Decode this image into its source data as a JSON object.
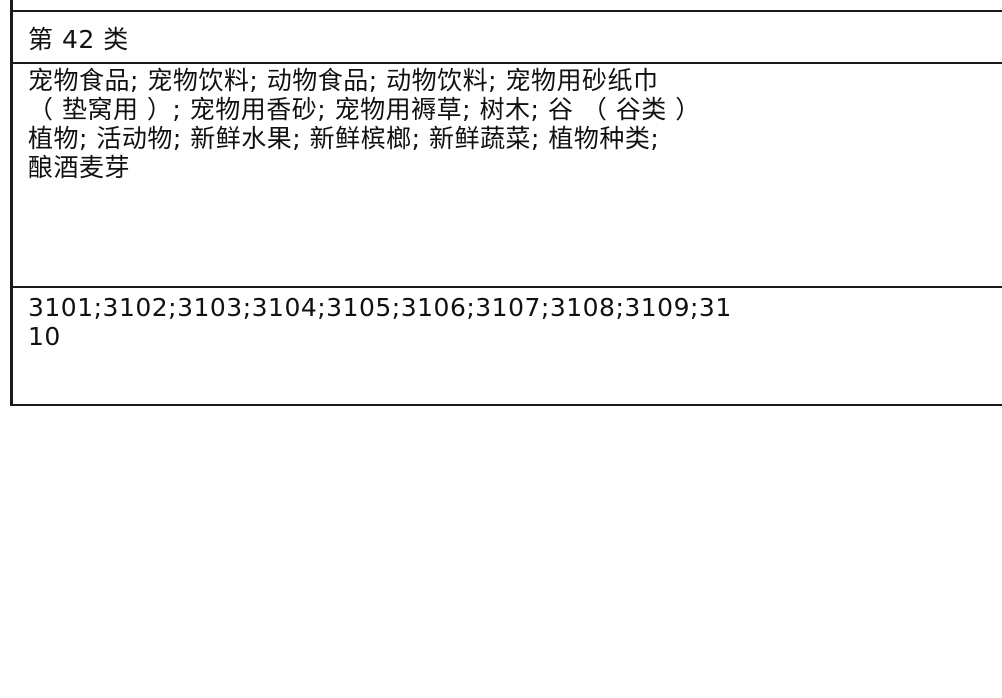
{
  "class_label": "第 42 类",
  "goods_lines": [
    "宠物食品; 宠物饮料; 动物食品; 动物饮料; 宠物用砂纸巾",
    "（ 垫窝用 ）; 宠物用香砂; 宠物用褥草; 树木; 谷 （ 谷类 ）",
    "植物; 活动物; 新鲜水果; 新鲜槟榔; 新鲜蔬菜; 植物种类;",
    "酿酒麦芽"
  ],
  "code_lines": [
    "3101;3102;3103;3104;3105;3106;3107;3108;3109;31",
    "10"
  ]
}
